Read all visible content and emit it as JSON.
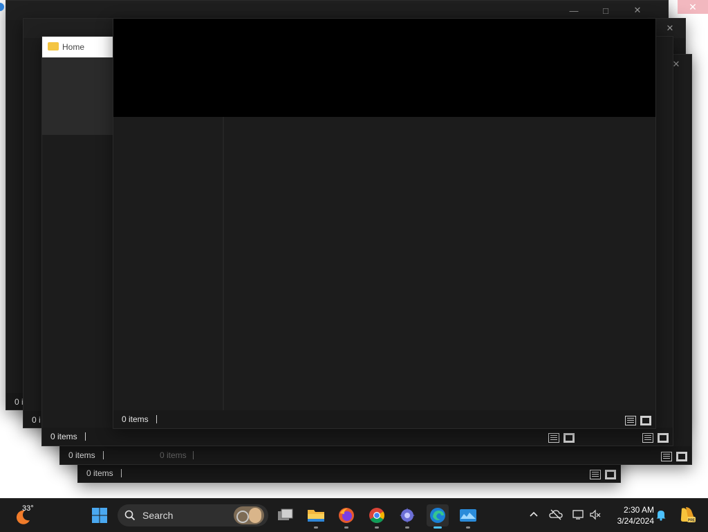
{
  "desktop": {
    "background": "#ffffff"
  },
  "explorer_windows": [
    {
      "id": "w1",
      "status": "0 i"
    },
    {
      "id": "w2",
      "status": "0 i"
    },
    {
      "id": "w3",
      "tab_title": "Home",
      "status": "0 items"
    },
    {
      "id": "w4",
      "status": "0 items",
      "status_alt": "0 items"
    },
    {
      "id": "w5",
      "status": "0 items"
    },
    {
      "id": "w6",
      "status": "0 items"
    }
  ],
  "taskbar": {
    "weather": {
      "temp": "33°",
      "icon": "moon-weather-icon"
    },
    "search_label": "Search",
    "apps": [
      {
        "name": "start",
        "icon": "windows-logo-icon"
      },
      {
        "name": "task-view",
        "icon": "task-view-icon"
      },
      {
        "name": "file-explorer",
        "icon": "folder-icon",
        "running": true
      },
      {
        "name": "firefox",
        "icon": "firefox-icon",
        "running": true
      },
      {
        "name": "chrome",
        "icon": "chrome-icon",
        "running": true
      },
      {
        "name": "app",
        "icon": "gear-app-icon",
        "running": true
      },
      {
        "name": "edge",
        "icon": "edge-icon",
        "running": true,
        "active": true
      },
      {
        "name": "photos",
        "icon": "photos-icon",
        "running": true
      }
    ],
    "clock": {
      "time": "2:30 AM",
      "date": "3/24/2024"
    },
    "colors": {
      "accent": "#4cc2ff",
      "taskbar_bg": "#1c1c1c"
    }
  }
}
